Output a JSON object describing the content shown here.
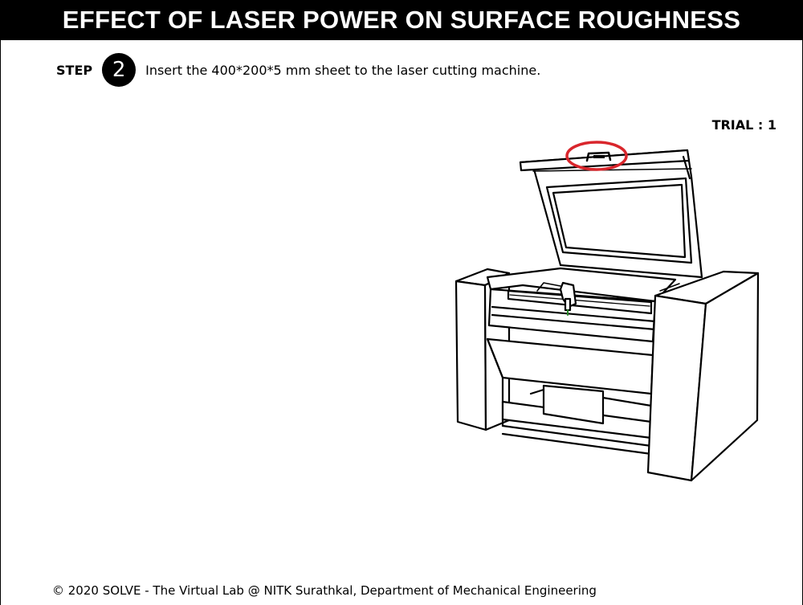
{
  "header": {
    "title": "EFFECT OF LASER POWER ON SURFACE ROUGHNESS"
  },
  "step": {
    "label": "STEP",
    "number": "2",
    "instruction": "Insert the 400*200*5 mm sheet to the laser cutting machine."
  },
  "trial": {
    "text": "TRIAL : 1"
  },
  "machine": {
    "highlight_color": "#d9262c",
    "highlight_target": "lid-handle"
  },
  "footer": {
    "text": "© 2020 SOLVE - The Virtual Lab @ NITK Surathkal, Department of Mechanical Engineering"
  }
}
